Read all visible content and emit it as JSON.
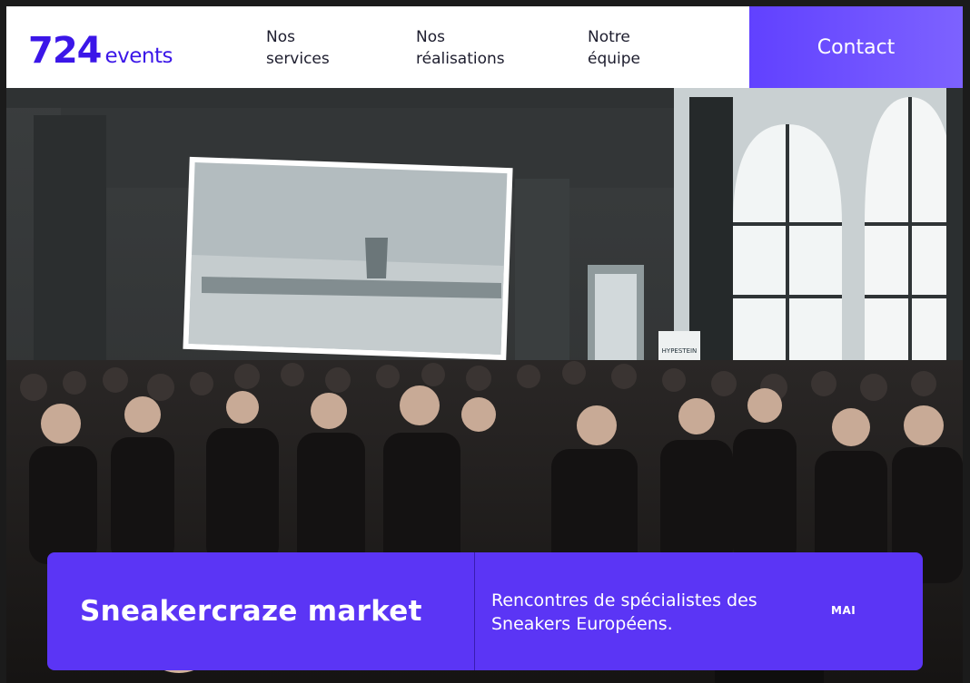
{
  "logo": {
    "number": "724",
    "word": "events"
  },
  "nav": {
    "services": {
      "line1": "Nos",
      "line2": "services"
    },
    "realisations": {
      "line1": "Nos",
      "line2": "réalisations"
    },
    "equipe": {
      "line1": "Notre",
      "line2": "équipe"
    }
  },
  "contact_label": "Contact",
  "hero": {
    "event_title": "Sneakercraze market",
    "event_description": "Rencontres de spécialistes des Sneakers Européens.",
    "event_month": "MAI",
    "banner_text": "HYPESTEIN"
  },
  "slider": {
    "count": 3,
    "active_index": 0
  },
  "colors": {
    "brand": "#3b16e8",
    "accent": "#5b35f5",
    "contact_bg": "#6b4dff"
  }
}
